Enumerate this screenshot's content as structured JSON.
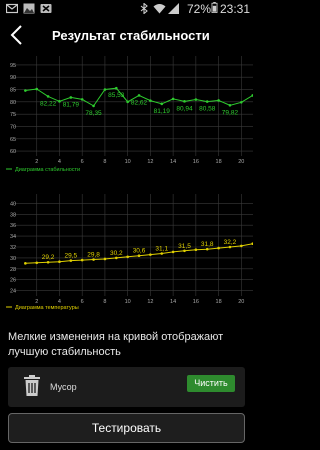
{
  "status_bar": {
    "battery_percent": "72%",
    "time": "23:31",
    "icons": [
      "mail-icon",
      "image-icon",
      "delete-icon",
      "bluetooth-icon",
      "wifi-icon",
      "signal-icon",
      "battery-icon"
    ]
  },
  "header": {
    "title": "Результат стабильности",
    "back_icon": "chevron-left-icon"
  },
  "chart_data": [
    {
      "type": "line",
      "legend": "Диаграмма стабильности",
      "y_ticks": [
        "95",
        "90",
        "85",
        "80",
        "75",
        "70",
        "65",
        "60"
      ],
      "x_ticks": [
        "2",
        "4",
        "6",
        "8",
        "10",
        "12",
        "14",
        "16",
        "18",
        "20"
      ],
      "x": [
        1,
        2,
        3,
        4,
        5,
        6,
        7,
        8,
        9,
        10,
        11,
        12,
        13,
        14,
        15,
        16,
        17,
        18,
        19,
        20,
        21
      ],
      "values": [
        84.6,
        85.2,
        82.22,
        80.2,
        81.79,
        81.0,
        78.35,
        85.0,
        85.53,
        80.0,
        82.62,
        80.5,
        79.2,
        81.19,
        80.2,
        80.94,
        80.1,
        80.58,
        78.6,
        79.82,
        82.6
      ],
      "data_labels": [
        "82,22",
        "81,79",
        "78,35",
        "85,53",
        "82,62",
        "81,19",
        "80,94",
        "80,58",
        "79,82"
      ],
      "ylim": [
        58,
        97
      ],
      "line_color": "#2ecc2e",
      "grid": true,
      "legend_position": "bottom-left"
    },
    {
      "type": "line",
      "legend": "Диаграмма температуры",
      "y_ticks": [
        "40",
        "38",
        "36",
        "34",
        "32",
        "30",
        "28",
        "26",
        "24"
      ],
      "x_ticks": [
        "2",
        "4",
        "6",
        "8",
        "10",
        "12",
        "14",
        "16",
        "18",
        "20"
      ],
      "x": [
        1,
        2,
        3,
        4,
        5,
        6,
        7,
        8,
        9,
        10,
        11,
        12,
        13,
        14,
        15,
        16,
        17,
        18,
        19,
        20,
        21
      ],
      "values": [
        29.0,
        29.1,
        29.2,
        29.3,
        29.5,
        29.6,
        29.7,
        29.8,
        30.0,
        30.2,
        30.4,
        30.6,
        30.8,
        31.1,
        31.3,
        31.5,
        31.6,
        31.8,
        32.0,
        32.2,
        32.6
      ],
      "data_labels": [
        "29,2",
        "29,5",
        "29,8",
        "30,2",
        "30,6",
        "31,1",
        "31,5",
        "31,8",
        "32,2"
      ],
      "ylim": [
        23,
        41
      ],
      "line_color": "#e0d000",
      "grid": true,
      "legend_position": "bottom-left"
    }
  ],
  "note": "Мелкие изменения на кривой отображают лучшую стабильность",
  "trash": {
    "label": "Мусор",
    "clean_button": "Чистить"
  },
  "test_button": "Тестировать"
}
